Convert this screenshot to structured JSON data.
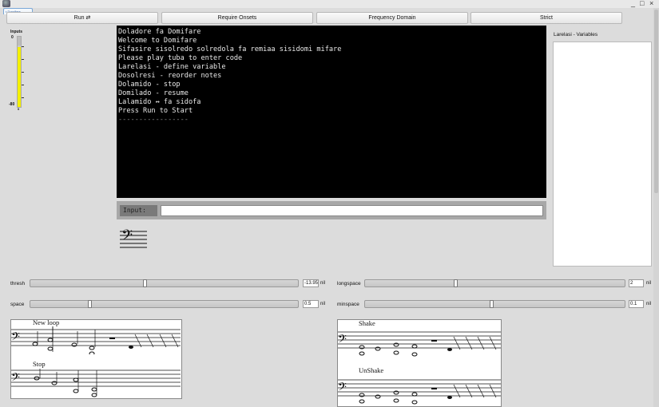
{
  "window": {
    "tab_label": "r Domifare",
    "controls": [
      "_",
      "□",
      "×"
    ]
  },
  "toolbar": [
    {
      "label": "Run ⇄"
    },
    {
      "label": "Require Onsets"
    },
    {
      "label": "Frequency Domain"
    },
    {
      "label": "Strict"
    }
  ],
  "meter": {
    "title": "Inputs",
    "top_label": "0",
    "bottom_label": "-80",
    "bottom_sub": "0",
    "level": 0.85,
    "color": "#f3f000"
  },
  "console": {
    "lines": [
      "Doladore fa Domifare",
      "Welcome to Domifare",
      "Sifasire sisolredo solredola fa remiaa sisidomi mifare",
      "Please play tuba to enter code",
      "Larelasi - define variable",
      "Dosolresi - reorder notes",
      "Dolamido - stop",
      "Domilado - resume",
      "Lalamido ↔ fa sidofa",
      "Press Run to Start",
      "-----------------"
    ]
  },
  "input": {
    "label": "Input:",
    "value": ""
  },
  "variables": {
    "title": "Larelasi - Variables"
  },
  "sliders": {
    "thresh": {
      "label": "thresh",
      "value": "-13.95",
      "unit": "nil",
      "position": 0.43
    },
    "longspace": {
      "label": "longspace",
      "value": "2",
      "unit": "nil",
      "position": 0.35
    },
    "space": {
      "label": "space",
      "value": "0.5",
      "unit": "nil",
      "position": 0.22
    },
    "minspace": {
      "label": "minspace",
      "value": "0.1",
      "unit": "nil",
      "position": 0.49
    }
  },
  "scores": {
    "new_loop": "New loop",
    "stop": "Stop",
    "shake": "Shake",
    "unshake": "UnShake"
  },
  "colors": {
    "console_bg": "#000000",
    "meter_fill": "#f3f000",
    "background": "#dcdcdc"
  }
}
